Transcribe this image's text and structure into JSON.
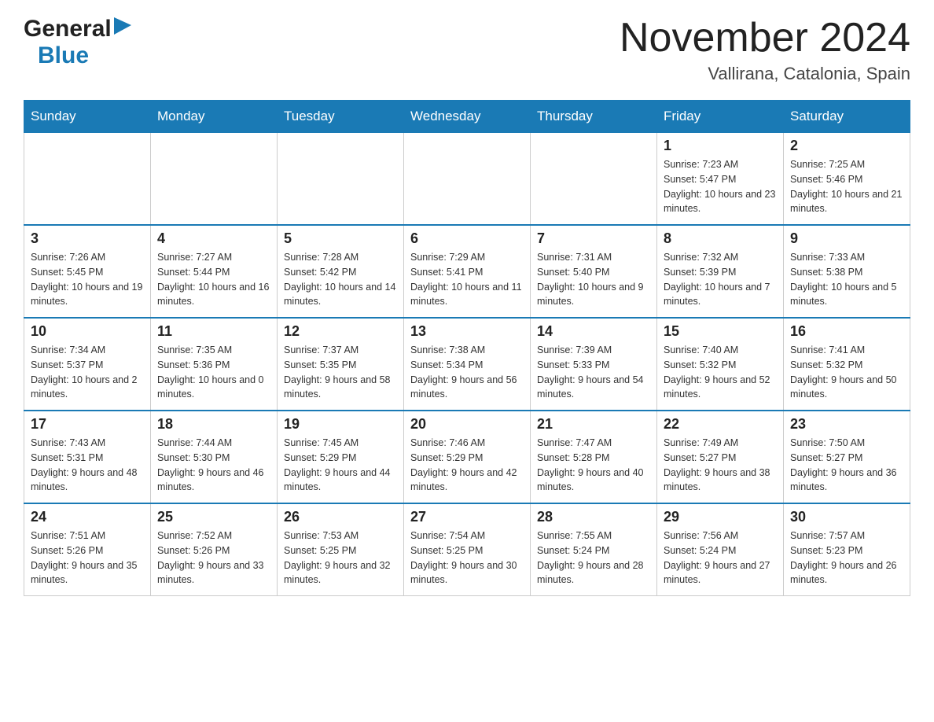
{
  "header": {
    "logo_general": "General",
    "logo_blue": "Blue",
    "month_title": "November 2024",
    "location": "Vallirana, Catalonia, Spain"
  },
  "days_of_week": [
    "Sunday",
    "Monday",
    "Tuesday",
    "Wednesday",
    "Thursday",
    "Friday",
    "Saturday"
  ],
  "weeks": [
    [
      {
        "day": "",
        "info": ""
      },
      {
        "day": "",
        "info": ""
      },
      {
        "day": "",
        "info": ""
      },
      {
        "day": "",
        "info": ""
      },
      {
        "day": "",
        "info": ""
      },
      {
        "day": "1",
        "info": "Sunrise: 7:23 AM\nSunset: 5:47 PM\nDaylight: 10 hours and 23 minutes."
      },
      {
        "day": "2",
        "info": "Sunrise: 7:25 AM\nSunset: 5:46 PM\nDaylight: 10 hours and 21 minutes."
      }
    ],
    [
      {
        "day": "3",
        "info": "Sunrise: 7:26 AM\nSunset: 5:45 PM\nDaylight: 10 hours and 19 minutes."
      },
      {
        "day": "4",
        "info": "Sunrise: 7:27 AM\nSunset: 5:44 PM\nDaylight: 10 hours and 16 minutes."
      },
      {
        "day": "5",
        "info": "Sunrise: 7:28 AM\nSunset: 5:42 PM\nDaylight: 10 hours and 14 minutes."
      },
      {
        "day": "6",
        "info": "Sunrise: 7:29 AM\nSunset: 5:41 PM\nDaylight: 10 hours and 11 minutes."
      },
      {
        "day": "7",
        "info": "Sunrise: 7:31 AM\nSunset: 5:40 PM\nDaylight: 10 hours and 9 minutes."
      },
      {
        "day": "8",
        "info": "Sunrise: 7:32 AM\nSunset: 5:39 PM\nDaylight: 10 hours and 7 minutes."
      },
      {
        "day": "9",
        "info": "Sunrise: 7:33 AM\nSunset: 5:38 PM\nDaylight: 10 hours and 5 minutes."
      }
    ],
    [
      {
        "day": "10",
        "info": "Sunrise: 7:34 AM\nSunset: 5:37 PM\nDaylight: 10 hours and 2 minutes."
      },
      {
        "day": "11",
        "info": "Sunrise: 7:35 AM\nSunset: 5:36 PM\nDaylight: 10 hours and 0 minutes."
      },
      {
        "day": "12",
        "info": "Sunrise: 7:37 AM\nSunset: 5:35 PM\nDaylight: 9 hours and 58 minutes."
      },
      {
        "day": "13",
        "info": "Sunrise: 7:38 AM\nSunset: 5:34 PM\nDaylight: 9 hours and 56 minutes."
      },
      {
        "day": "14",
        "info": "Sunrise: 7:39 AM\nSunset: 5:33 PM\nDaylight: 9 hours and 54 minutes."
      },
      {
        "day": "15",
        "info": "Sunrise: 7:40 AM\nSunset: 5:32 PM\nDaylight: 9 hours and 52 minutes."
      },
      {
        "day": "16",
        "info": "Sunrise: 7:41 AM\nSunset: 5:32 PM\nDaylight: 9 hours and 50 minutes."
      }
    ],
    [
      {
        "day": "17",
        "info": "Sunrise: 7:43 AM\nSunset: 5:31 PM\nDaylight: 9 hours and 48 minutes."
      },
      {
        "day": "18",
        "info": "Sunrise: 7:44 AM\nSunset: 5:30 PM\nDaylight: 9 hours and 46 minutes."
      },
      {
        "day": "19",
        "info": "Sunrise: 7:45 AM\nSunset: 5:29 PM\nDaylight: 9 hours and 44 minutes."
      },
      {
        "day": "20",
        "info": "Sunrise: 7:46 AM\nSunset: 5:29 PM\nDaylight: 9 hours and 42 minutes."
      },
      {
        "day": "21",
        "info": "Sunrise: 7:47 AM\nSunset: 5:28 PM\nDaylight: 9 hours and 40 minutes."
      },
      {
        "day": "22",
        "info": "Sunrise: 7:49 AM\nSunset: 5:27 PM\nDaylight: 9 hours and 38 minutes."
      },
      {
        "day": "23",
        "info": "Sunrise: 7:50 AM\nSunset: 5:27 PM\nDaylight: 9 hours and 36 minutes."
      }
    ],
    [
      {
        "day": "24",
        "info": "Sunrise: 7:51 AM\nSunset: 5:26 PM\nDaylight: 9 hours and 35 minutes."
      },
      {
        "day": "25",
        "info": "Sunrise: 7:52 AM\nSunset: 5:26 PM\nDaylight: 9 hours and 33 minutes."
      },
      {
        "day": "26",
        "info": "Sunrise: 7:53 AM\nSunset: 5:25 PM\nDaylight: 9 hours and 32 minutes."
      },
      {
        "day": "27",
        "info": "Sunrise: 7:54 AM\nSunset: 5:25 PM\nDaylight: 9 hours and 30 minutes."
      },
      {
        "day": "28",
        "info": "Sunrise: 7:55 AM\nSunset: 5:24 PM\nDaylight: 9 hours and 28 minutes."
      },
      {
        "day": "29",
        "info": "Sunrise: 7:56 AM\nSunset: 5:24 PM\nDaylight: 9 hours and 27 minutes."
      },
      {
        "day": "30",
        "info": "Sunrise: 7:57 AM\nSunset: 5:23 PM\nDaylight: 9 hours and 26 minutes."
      }
    ]
  ]
}
